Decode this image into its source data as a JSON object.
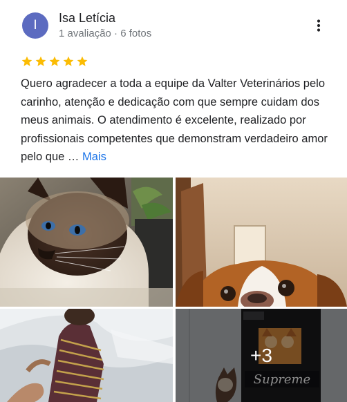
{
  "reviewer": {
    "initial": "I",
    "name": "Isa Letícia",
    "meta": "1 avaliação · 6 fotos",
    "avatar_color": "#5c6bc0"
  },
  "menu": {
    "icon": "more-vert-icon"
  },
  "rating": {
    "stars": 5,
    "max": 5,
    "star_color": "#fbbc04"
  },
  "review": {
    "text": "Quero agradecer a toda a equipe da Valter Veterinários pelo carinho, atenção e dedicação com que sempre cuidam dos meus animais. O atendimento é excelente, realizado por profissionais competentes que demonstram verdadeiro amor pelo que … ",
    "more_label": "Mais",
    "more_color": "#1a73e8"
  },
  "photos": {
    "items": [
      {
        "subject": "siamese-cat"
      },
      {
        "subject": "beagle-dog"
      },
      {
        "subject": "cat-in-striped-shirt"
      },
      {
        "subject": "cat-food-bag"
      }
    ],
    "more_count_label": "+3",
    "food_bag_label": "Supreme"
  }
}
